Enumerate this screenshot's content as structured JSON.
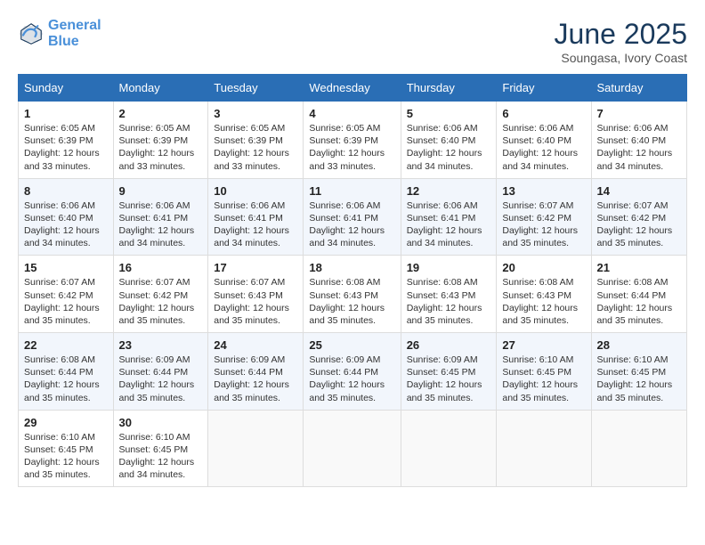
{
  "header": {
    "logo_line1": "General",
    "logo_line2": "Blue",
    "title": "June 2025",
    "subtitle": "Soungasa, Ivory Coast"
  },
  "days_of_week": [
    "Sunday",
    "Monday",
    "Tuesday",
    "Wednesday",
    "Thursday",
    "Friday",
    "Saturday"
  ],
  "weeks": [
    [
      {
        "day": "1",
        "detail": "Sunrise: 6:05 AM\nSunset: 6:39 PM\nDaylight: 12 hours\nand 33 minutes."
      },
      {
        "day": "2",
        "detail": "Sunrise: 6:05 AM\nSunset: 6:39 PM\nDaylight: 12 hours\nand 33 minutes."
      },
      {
        "day": "3",
        "detail": "Sunrise: 6:05 AM\nSunset: 6:39 PM\nDaylight: 12 hours\nand 33 minutes."
      },
      {
        "day": "4",
        "detail": "Sunrise: 6:05 AM\nSunset: 6:39 PM\nDaylight: 12 hours\nand 33 minutes."
      },
      {
        "day": "5",
        "detail": "Sunrise: 6:06 AM\nSunset: 6:40 PM\nDaylight: 12 hours\nand 34 minutes."
      },
      {
        "day": "6",
        "detail": "Sunrise: 6:06 AM\nSunset: 6:40 PM\nDaylight: 12 hours\nand 34 minutes."
      },
      {
        "day": "7",
        "detail": "Sunrise: 6:06 AM\nSunset: 6:40 PM\nDaylight: 12 hours\nand 34 minutes."
      }
    ],
    [
      {
        "day": "8",
        "detail": "Sunrise: 6:06 AM\nSunset: 6:40 PM\nDaylight: 12 hours\nand 34 minutes."
      },
      {
        "day": "9",
        "detail": "Sunrise: 6:06 AM\nSunset: 6:41 PM\nDaylight: 12 hours\nand 34 minutes."
      },
      {
        "day": "10",
        "detail": "Sunrise: 6:06 AM\nSunset: 6:41 PM\nDaylight: 12 hours\nand 34 minutes."
      },
      {
        "day": "11",
        "detail": "Sunrise: 6:06 AM\nSunset: 6:41 PM\nDaylight: 12 hours\nand 34 minutes."
      },
      {
        "day": "12",
        "detail": "Sunrise: 6:06 AM\nSunset: 6:41 PM\nDaylight: 12 hours\nand 34 minutes."
      },
      {
        "day": "13",
        "detail": "Sunrise: 6:07 AM\nSunset: 6:42 PM\nDaylight: 12 hours\nand 35 minutes."
      },
      {
        "day": "14",
        "detail": "Sunrise: 6:07 AM\nSunset: 6:42 PM\nDaylight: 12 hours\nand 35 minutes."
      }
    ],
    [
      {
        "day": "15",
        "detail": "Sunrise: 6:07 AM\nSunset: 6:42 PM\nDaylight: 12 hours\nand 35 minutes."
      },
      {
        "day": "16",
        "detail": "Sunrise: 6:07 AM\nSunset: 6:42 PM\nDaylight: 12 hours\nand 35 minutes."
      },
      {
        "day": "17",
        "detail": "Sunrise: 6:07 AM\nSunset: 6:43 PM\nDaylight: 12 hours\nand 35 minutes."
      },
      {
        "day": "18",
        "detail": "Sunrise: 6:08 AM\nSunset: 6:43 PM\nDaylight: 12 hours\nand 35 minutes."
      },
      {
        "day": "19",
        "detail": "Sunrise: 6:08 AM\nSunset: 6:43 PM\nDaylight: 12 hours\nand 35 minutes."
      },
      {
        "day": "20",
        "detail": "Sunrise: 6:08 AM\nSunset: 6:43 PM\nDaylight: 12 hours\nand 35 minutes."
      },
      {
        "day": "21",
        "detail": "Sunrise: 6:08 AM\nSunset: 6:44 PM\nDaylight: 12 hours\nand 35 minutes."
      }
    ],
    [
      {
        "day": "22",
        "detail": "Sunrise: 6:08 AM\nSunset: 6:44 PM\nDaylight: 12 hours\nand 35 minutes."
      },
      {
        "day": "23",
        "detail": "Sunrise: 6:09 AM\nSunset: 6:44 PM\nDaylight: 12 hours\nand 35 minutes."
      },
      {
        "day": "24",
        "detail": "Sunrise: 6:09 AM\nSunset: 6:44 PM\nDaylight: 12 hours\nand 35 minutes."
      },
      {
        "day": "25",
        "detail": "Sunrise: 6:09 AM\nSunset: 6:44 PM\nDaylight: 12 hours\nand 35 minutes."
      },
      {
        "day": "26",
        "detail": "Sunrise: 6:09 AM\nSunset: 6:45 PM\nDaylight: 12 hours\nand 35 minutes."
      },
      {
        "day": "27",
        "detail": "Sunrise: 6:10 AM\nSunset: 6:45 PM\nDaylight: 12 hours\nand 35 minutes."
      },
      {
        "day": "28",
        "detail": "Sunrise: 6:10 AM\nSunset: 6:45 PM\nDaylight: 12 hours\nand 35 minutes."
      }
    ],
    [
      {
        "day": "29",
        "detail": "Sunrise: 6:10 AM\nSunset: 6:45 PM\nDaylight: 12 hours\nand 35 minutes."
      },
      {
        "day": "30",
        "detail": "Sunrise: 6:10 AM\nSunset: 6:45 PM\nDaylight: 12 hours\nand 34 minutes."
      },
      null,
      null,
      null,
      null,
      null
    ]
  ]
}
